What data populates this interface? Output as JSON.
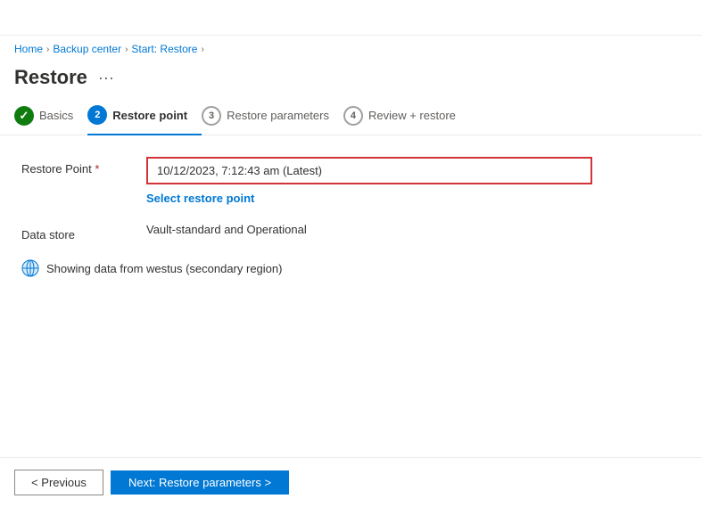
{
  "topbar": {
    "icon_label": "azure-icon"
  },
  "breadcrumb": {
    "items": [
      {
        "label": "Home",
        "link": true
      },
      {
        "label": "Backup center",
        "link": true
      },
      {
        "label": "Start: Restore",
        "link": true
      }
    ],
    "chevron": "›"
  },
  "page": {
    "title": "Restore",
    "more_label": "···"
  },
  "steps": [
    {
      "id": "basics",
      "number": "✓",
      "label": "Basics",
      "state": "completed"
    },
    {
      "id": "restore-point",
      "number": "2",
      "label": "Restore point",
      "state": "active"
    },
    {
      "id": "restore-parameters",
      "number": "3",
      "label": "Restore parameters",
      "state": "inactive"
    },
    {
      "id": "review-restore",
      "number": "4",
      "label": "Review + restore",
      "state": "inactive"
    }
  ],
  "form": {
    "restore_point": {
      "label": "Restore Point",
      "required": true,
      "value": "10/12/2023, 7:12:43 am (Latest)",
      "select_link_label": "Select restore point"
    },
    "data_store": {
      "label": "Data store",
      "value": "Vault-standard and Operational"
    }
  },
  "info": {
    "text": "Showing data from westus (secondary region)"
  },
  "actions": {
    "previous_label": "< Previous",
    "next_label": "Next: Restore parameters >"
  }
}
